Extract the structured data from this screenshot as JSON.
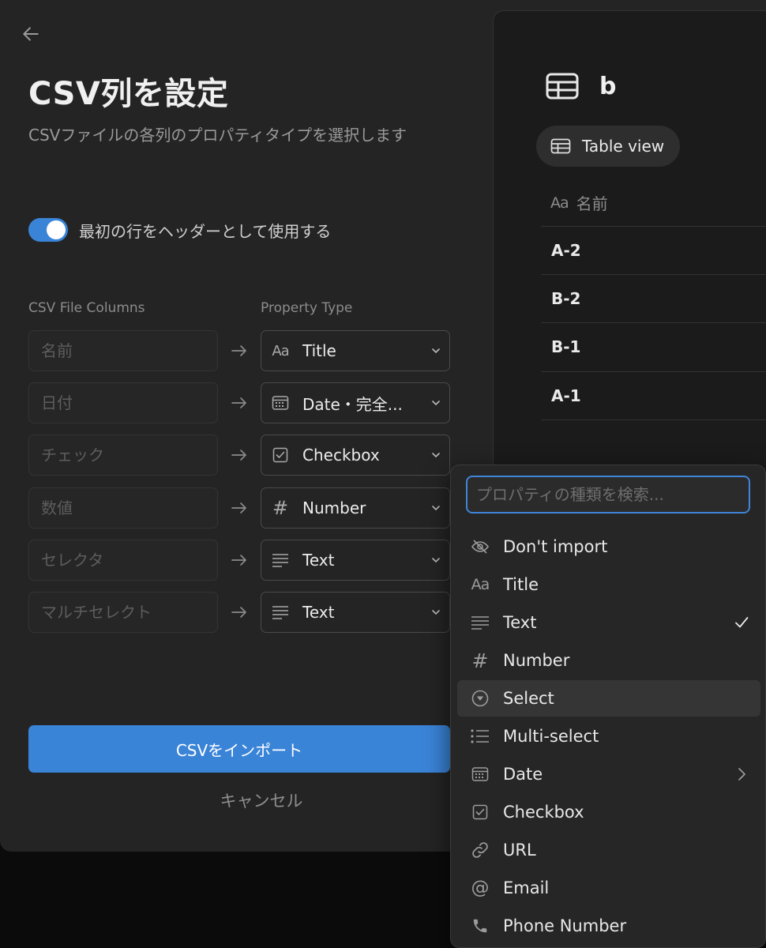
{
  "modal": {
    "title": "CSV列を設定",
    "subtitle": "CSVファイルの各列のプロパティタイプを選択します",
    "header_toggle": {
      "label": "最初の行をヘッダーとして使用する",
      "on": true
    },
    "columns_header": "CSV File Columns",
    "property_header": "Property Type",
    "rows": [
      {
        "column": "名前",
        "icon": "title-icon",
        "type": "Title"
      },
      {
        "column": "日付",
        "icon": "calendar-icon",
        "type": "Date・完全..."
      },
      {
        "column": "チェック",
        "icon": "checkbox-icon",
        "type": "Checkbox"
      },
      {
        "column": "数値",
        "icon": "hash-icon",
        "type": "Number"
      },
      {
        "column": "セレクタ",
        "icon": "text-lines-icon",
        "type": "Text"
      },
      {
        "column": "マルチセレクト",
        "icon": "text-lines-icon",
        "type": "Text"
      }
    ],
    "import_label": "CSVをインポート",
    "cancel_label": "キャンセル"
  },
  "preview": {
    "title": "b",
    "view_label": "Table view",
    "column_header": "名前",
    "rows": [
      "A-2",
      "B-2",
      "B-1",
      "A-1"
    ]
  },
  "dropdown": {
    "search_placeholder": "プロパティの種類を検索...",
    "items": [
      {
        "label": "Don't import",
        "icon": "eye-off-icon"
      },
      {
        "label": "Title",
        "icon": "title-icon"
      },
      {
        "label": "Text",
        "icon": "text-lines-icon",
        "checked": true
      },
      {
        "label": "Number",
        "icon": "hash-icon"
      },
      {
        "label": "Select",
        "icon": "select-circle-icon",
        "hovered": true
      },
      {
        "label": "Multi-select",
        "icon": "list-icon"
      },
      {
        "label": "Date",
        "icon": "calendar-icon",
        "submenu": true
      },
      {
        "label": "Checkbox",
        "icon": "checkbox-icon"
      },
      {
        "label": "URL",
        "icon": "link-icon"
      },
      {
        "label": "Email",
        "icon": "at-icon"
      },
      {
        "label": "Phone Number",
        "icon": "phone-icon"
      }
    ]
  },
  "colors": {
    "accent": "#3a84d8",
    "modal_bg": "#242424",
    "preview_bg": "#1b1b1b",
    "dropdown_bg": "#262626"
  }
}
